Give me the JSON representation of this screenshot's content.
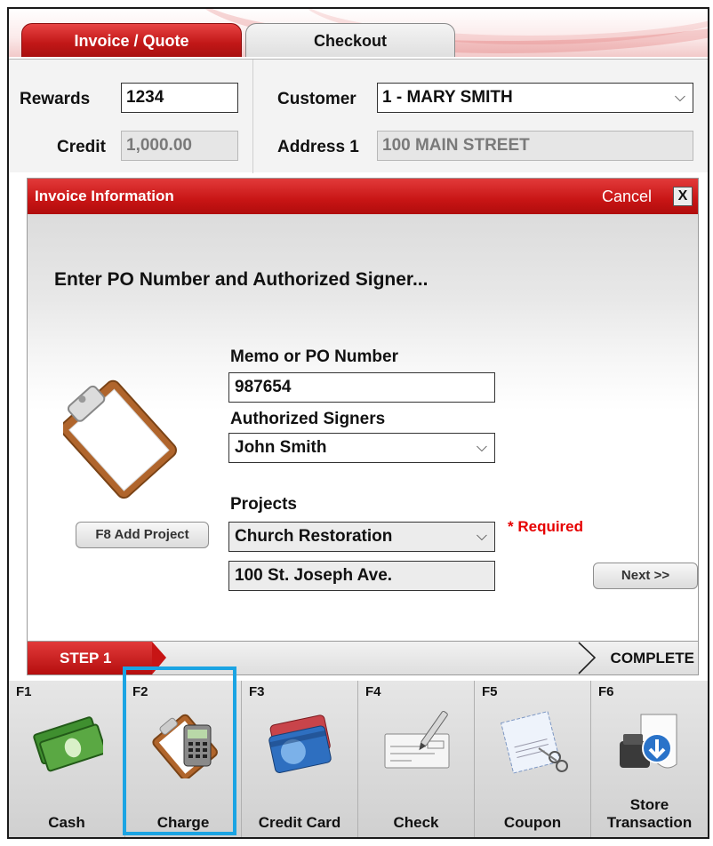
{
  "tabs": [
    {
      "label": "Invoice / Quote",
      "active": false
    },
    {
      "label": "Checkout",
      "active": true
    }
  ],
  "header": {
    "rewards_label": "Rewards",
    "rewards_value": "1234",
    "credit_label": "Credit",
    "credit_value": "1,000.00",
    "customer_label": "Customer",
    "customer_value": "1 - MARY SMITH",
    "address_label": "Address 1",
    "address_value": "100 MAIN STREET"
  },
  "dialog": {
    "title": "Invoice Information",
    "cancel_label": "Cancel",
    "close_label": "X",
    "prompt": "Enter PO Number and Authorized Signer...",
    "memo_label": "Memo or PO Number",
    "memo_value": "987654",
    "signers_label": "Authorized Signers",
    "signers_value": "John Smith",
    "projects_label": "Projects",
    "projects_value": "Church Restoration",
    "project_address_value": "100 St. Joseph Ave.",
    "required_label": "* Required",
    "add_project_label": "F8 Add Project",
    "next_label": "Next >>"
  },
  "steps": {
    "current": "STEP 1",
    "final": "COMPLETE"
  },
  "fkeys": [
    {
      "key": "F1",
      "label": "Cash",
      "icon": "cash-icon"
    },
    {
      "key": "F2",
      "label": "Charge",
      "icon": "charge-icon"
    },
    {
      "key": "F3",
      "label": "Credit Card",
      "icon": "credit-card-icon"
    },
    {
      "key": "F4",
      "label": "Check",
      "icon": "check-icon"
    },
    {
      "key": "F5",
      "label": "Coupon",
      "icon": "coupon-icon"
    },
    {
      "key": "F6",
      "label_line1": "Store",
      "label_line2": "Transaction",
      "icon": "store-transaction-icon"
    }
  ],
  "colors": {
    "brand_red": "#c81515",
    "highlight_blue": "#1ba4e3",
    "required_red": "#e60000"
  }
}
